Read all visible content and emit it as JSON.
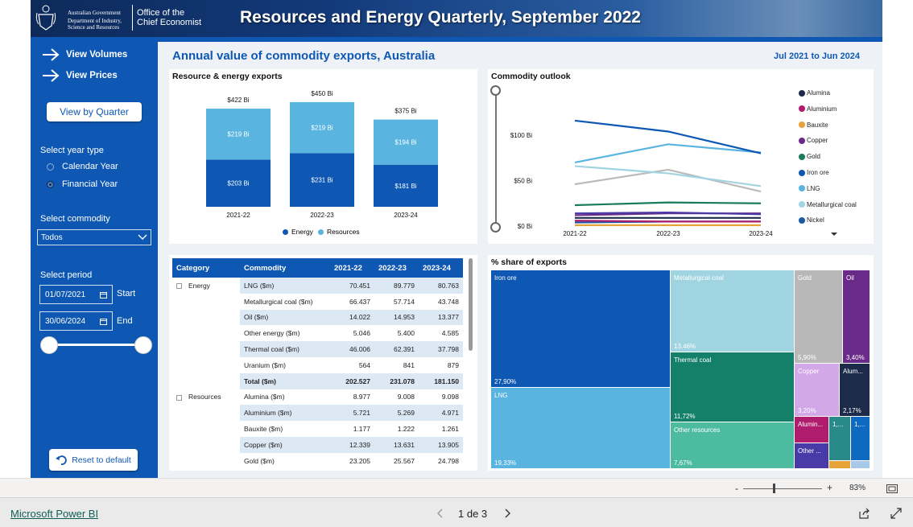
{
  "header": {
    "govt_line1": "Australian Government",
    "govt_line2": "Department of Industry,",
    "govt_line3": "Science and Resources",
    "office_line1": "Office of the",
    "office_line2": "Chief Economist",
    "title": "Resources and Energy Quarterly, September 2022"
  },
  "sidebar": {
    "view_volumes": "View Volumes",
    "view_prices": "View Prices",
    "view_by_quarter": "View by Quarter",
    "year_type_label": "Select year type",
    "year_types": [
      "Calendar Year",
      "Financial Year"
    ],
    "selected_year_type": "Financial Year",
    "commodity_label": "Select commodity",
    "commodity_value": "Todos",
    "period_label": "Select period",
    "start_date": "01/07/2021",
    "start_label": "Start",
    "end_date": "30/06/2024",
    "end_label": "End",
    "reset_label": "Reset to default"
  },
  "main": {
    "heading": "Annual value of commodity exports, Australia",
    "date_range": "Jul 2021 to Jun 2024"
  },
  "bar_card": {
    "title": "Resource & energy exports",
    "legend": [
      "Energy",
      "Resources"
    ],
    "colors": {
      "Energy": "#0e58b4",
      "Resources": "#5ab4e0"
    }
  },
  "line_card": {
    "title": "Commodity outlook",
    "y_ticks": [
      "$100 Bi",
      "$50 Bi",
      "$0 Bi"
    ],
    "x_ticks": [
      "2021-22",
      "2022-23",
      "2023-24"
    ],
    "legend": [
      {
        "name": "Alumina",
        "color": "#1c2b4a"
      },
      {
        "name": "Aluminium",
        "color": "#b01c6e"
      },
      {
        "name": "Bauxite",
        "color": "#e8a23a"
      },
      {
        "name": "Copper",
        "color": "#6a2a8a"
      },
      {
        "name": "Gold",
        "color": "#1a7a5a"
      },
      {
        "name": "Iron ore",
        "color": "#0e58b4"
      },
      {
        "name": "LNG",
        "color": "#5ab4e0"
      },
      {
        "name": "Metallurgical coal",
        "color": "#a0d4e0"
      },
      {
        "name": "Nickel",
        "color": "#1a5aa0"
      }
    ]
  },
  "table_card": {
    "columns": [
      "Category",
      "Commodity",
      "2021-22",
      "2022-23",
      "2023-24"
    ],
    "rows": [
      {
        "category": "Energy",
        "commodity": "LNG ($m)",
        "v": [
          "70.451",
          "89.779",
          "80.763"
        ]
      },
      {
        "category": "",
        "commodity": "Metallurgical coal ($m)",
        "v": [
          "66.437",
          "57.714",
          "43.748"
        ]
      },
      {
        "category": "",
        "commodity": "Oil ($m)",
        "v": [
          "14.022",
          "14.953",
          "13.377"
        ]
      },
      {
        "category": "",
        "commodity": "Other energy ($m)",
        "v": [
          "5.046",
          "5.400",
          "4.585"
        ]
      },
      {
        "category": "",
        "commodity": "Thermal coal ($m)",
        "v": [
          "46.006",
          "62.391",
          "37.798"
        ]
      },
      {
        "category": "",
        "commodity": "Uranium ($m)",
        "v": [
          "564",
          "841",
          "879"
        ]
      },
      {
        "category": "",
        "commodity": "Total ($m)",
        "v": [
          "202.527",
          "231.078",
          "181.150"
        ]
      },
      {
        "category": "Resources",
        "commodity": "Alumina ($m)",
        "v": [
          "8.977",
          "9.008",
          "9.098"
        ]
      },
      {
        "category": "",
        "commodity": "Aluminium ($m)",
        "v": [
          "5.721",
          "5.269",
          "4.971"
        ]
      },
      {
        "category": "",
        "commodity": "Bauxite ($m)",
        "v": [
          "1.177",
          "1.222",
          "1.261"
        ]
      },
      {
        "category": "",
        "commodity": "Copper ($m)",
        "v": [
          "12.339",
          "13.631",
          "13.905"
        ]
      },
      {
        "category": "",
        "commodity": "Gold ($m)",
        "v": [
          "23.205",
          "25.567",
          "24.798"
        ]
      }
    ]
  },
  "tree_card": {
    "title": "% share of exports",
    "cells": [
      {
        "name": "Iron ore",
        "pct": "27,90%",
        "color": "#0e58b4"
      },
      {
        "name": "LNG",
        "pct": "19,33%",
        "color": "#5ab4e0"
      },
      {
        "name": "Metallurgical coal",
        "pct": "13,46%",
        "color": "#a0d4e0"
      },
      {
        "name": "Thermal coal",
        "pct": "11,72%",
        "color": "#14806a"
      },
      {
        "name": "Other resources",
        "pct": "7,67%",
        "color": "#4dbba0"
      },
      {
        "name": "Gold",
        "pct": "5,90%",
        "color": "#b8b8b8"
      },
      {
        "name": "Oil",
        "pct": "3,40%",
        "color": "#6a2a8a"
      },
      {
        "name": "Copper",
        "pct": "3,20%",
        "color": "#d2a8e8"
      },
      {
        "name": "Alum...",
        "pct": "2,17%",
        "color": "#1c2b4a"
      },
      {
        "name": "Alumin...",
        "pct": "",
        "color": "#b01c6e"
      },
      {
        "name": "Other ...",
        "pct": "",
        "color": "#4a3aa8"
      },
      {
        "name": "1,...",
        "pct": "",
        "color": "#2a8a8a"
      },
      {
        "name": "1,...",
        "pct": "",
        "color": "#0e6ac0"
      }
    ]
  },
  "chart_data": [
    {
      "type": "bar",
      "title": "Resource & energy exports",
      "categories": [
        "2021-22",
        "2022-23",
        "2023-24"
      ],
      "series": [
        {
          "name": "Energy",
          "values": [
            203,
            231,
            181
          ],
          "labels": [
            "$203 Bi",
            "$231 Bi",
            "$181 Bi"
          ]
        },
        {
          "name": "Resources",
          "values": [
            219,
            219,
            194
          ],
          "labels": [
            "$219 Bi",
            "$219 Bi",
            "$194 Bi"
          ]
        }
      ],
      "totals": [
        "$422 Bi",
        "$450 Bi",
        "$375 Bi"
      ],
      "stacked": true,
      "ylim": [
        0,
        460
      ]
    },
    {
      "type": "line",
      "title": "Commodity outlook",
      "x": [
        "2021-22",
        "2022-23",
        "2023-24"
      ],
      "ylim": [
        0,
        120
      ],
      "series": [
        {
          "name": "Iron ore",
          "values": [
            116,
            104,
            80
          ]
        },
        {
          "name": "LNG",
          "values": [
            70,
            90,
            81
          ]
        },
        {
          "name": "Metallurgical coal",
          "values": [
            66,
            58,
            44
          ]
        },
        {
          "name": "Thermal coal",
          "values": [
            46,
            62,
            38
          ]
        },
        {
          "name": "Gold",
          "values": [
            23,
            26,
            25
          ]
        },
        {
          "name": "Oil",
          "values": [
            14,
            15,
            13
          ]
        },
        {
          "name": "Copper",
          "values": [
            12,
            14,
            14
          ]
        },
        {
          "name": "Alumina",
          "values": [
            9,
            9,
            9
          ]
        },
        {
          "name": "Aluminium",
          "values": [
            6,
            5,
            5
          ]
        },
        {
          "name": "Nickel",
          "values": [
            4,
            5,
            5
          ]
        },
        {
          "name": "Bauxite",
          "values": [
            1,
            1,
            1
          ]
        }
      ]
    }
  ],
  "statusbar": {
    "zoom": "83%"
  },
  "footer": {
    "brand": "Microsoft Power BI",
    "page": "1 de 3"
  }
}
